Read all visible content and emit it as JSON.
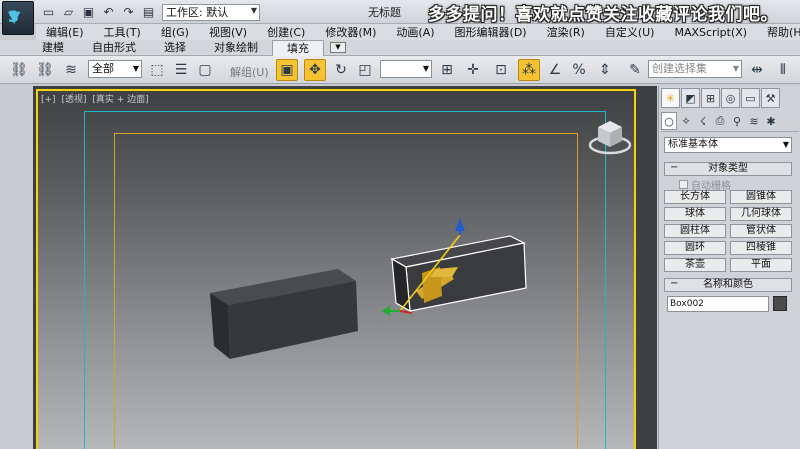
{
  "titlebar": {
    "workspace_value": "工作区: 默认",
    "doc_title": "无标题",
    "banner": "多多提问！喜欢就点赞关注收藏评论我们吧。"
  },
  "menu": [
    "编辑(E)",
    "工具(T)",
    "组(G)",
    "视图(V)",
    "创建(C)",
    "修改器(M)",
    "动画(A)",
    "图形编辑器(D)",
    "渲染(R)",
    "自定义(U)",
    "MAXScript(X)",
    "帮助(H)"
  ],
  "ribbon_tabs": [
    "建模",
    "自由形式",
    "选择",
    "对象绘制",
    "填充"
  ],
  "ribbon_active": "填充",
  "toolbar": {
    "selection_filter": "全部",
    "unlink_label": "解组(U)",
    "named_set_placeholder": "创建选择集"
  },
  "viewport": {
    "labels": [
      "[+]",
      "[透视]",
      "[真实 + 边面]"
    ]
  },
  "command_panel": {
    "category": "标准基本体",
    "rollout_object_type": "对象类型",
    "autogrid_label": "自动栅格",
    "object_buttons": [
      "长方体",
      "圆锥体",
      "球体",
      "几何球体",
      "圆柱体",
      "管状体",
      "圆环",
      "四棱锥",
      "茶壶",
      "平面"
    ],
    "rollout_name_color": "名称和颜色",
    "object_name": "Box002",
    "object_color": "#4b4b4b"
  },
  "colors": {
    "viewport_border": "#f2d40e",
    "safe_frame_outer": "#1fb6c9",
    "safe_frame_inner": "#d8a325",
    "active_tool": "#f5c232"
  }
}
